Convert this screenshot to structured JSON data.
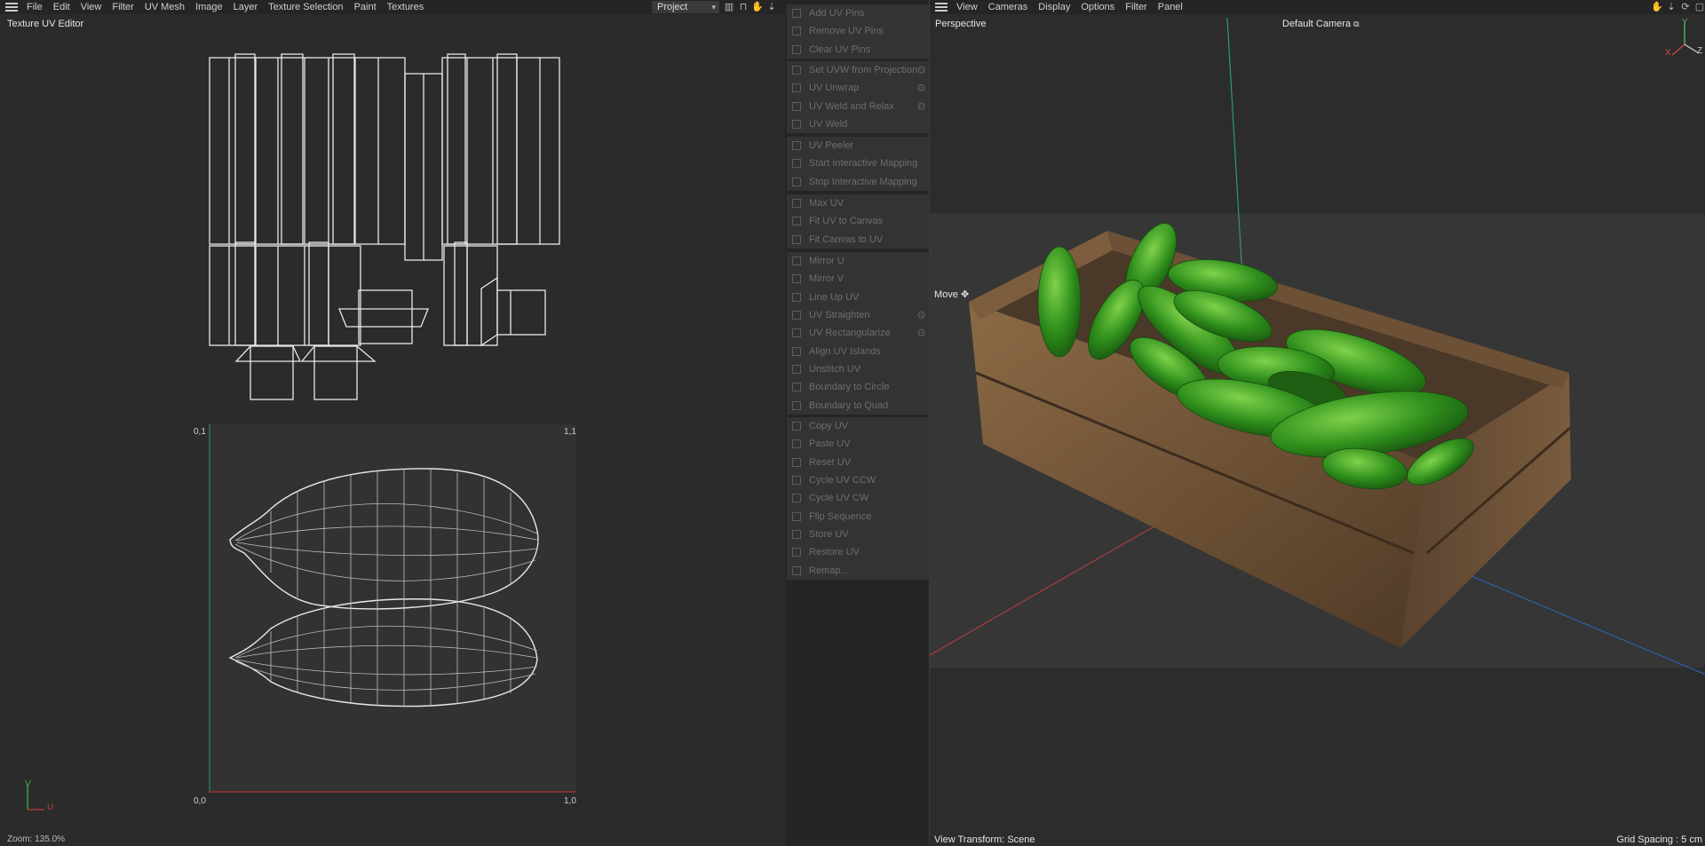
{
  "uv_editor": {
    "menu": [
      "File",
      "Edit",
      "View",
      "Filter",
      "UV Mesh",
      "Image",
      "Layer",
      "Texture Selection",
      "Paint",
      "Textures"
    ],
    "project_select": "Project",
    "title": "Texture UV Editor",
    "corners": {
      "top_left": "0,1",
      "top_right": "1,1",
      "bottom_left": "0,0",
      "bottom_right": "1,0"
    },
    "zoom": "Zoom: 135.0%",
    "axis_u": "U",
    "axis_v": "V"
  },
  "commands": {
    "groups": [
      {
        "items": [
          {
            "label": "Add UV Pins",
            "icon": "pin-icon"
          },
          {
            "label": "Remove UV Pins",
            "icon": "unpin-icon"
          },
          {
            "label": "Clear UV Pins",
            "icon": "close-icon"
          }
        ]
      },
      {
        "items": [
          {
            "label": "Set UVW from Projection",
            "icon": "projection-icon",
            "gear": true
          },
          {
            "label": "UV Unwrap",
            "icon": "unwrap-icon",
            "gear": true
          },
          {
            "label": "UV Weld and Relax",
            "icon": "weld-relax-icon",
            "gear": true
          },
          {
            "label": "UV Weld",
            "icon": "weld-icon"
          }
        ]
      },
      {
        "items": [
          {
            "label": "UV Peeler",
            "icon": "peeler-icon"
          },
          {
            "label": "Start Interactive Mapping",
            "icon": "play-icon"
          },
          {
            "label": "Stop Interactive Mapping",
            "icon": "stop-icon"
          }
        ]
      },
      {
        "items": [
          {
            "label": "Max UV",
            "icon": "max-icon"
          },
          {
            "label": "Fit UV to Canvas",
            "icon": "fit-uv-icon"
          },
          {
            "label": "Fit Canvas to UV",
            "icon": "fit-canvas-icon"
          }
        ]
      },
      {
        "items": [
          {
            "label": "Mirror U",
            "icon": "mirror-u-icon"
          },
          {
            "label": "Mirror V",
            "icon": "mirror-v-icon"
          },
          {
            "label": "Line Up UV",
            "icon": "line-up-icon"
          },
          {
            "label": "UV Straighten",
            "icon": "straighten-icon",
            "gear": true
          },
          {
            "label": "UV Rectangularize",
            "icon": "rectangularize-icon",
            "gear": true
          },
          {
            "label": "Align UV Islands",
            "icon": "align-icon"
          },
          {
            "label": "Unstitch UV",
            "icon": "unstitch-icon"
          },
          {
            "label": "Boundary to Circle",
            "icon": "circle-icon"
          },
          {
            "label": "Boundary to Quad",
            "icon": "quad-icon"
          }
        ]
      },
      {
        "items": [
          {
            "label": "Copy UV",
            "icon": "copy-icon"
          },
          {
            "label": "Paste UV",
            "icon": "paste-icon"
          },
          {
            "label": "Reset UV",
            "icon": "reset-icon"
          },
          {
            "label": "Cycle UV CCW",
            "icon": "ccw-icon"
          },
          {
            "label": "Cycle UV CW",
            "icon": "cw-icon"
          },
          {
            "label": "Flip Sequence",
            "icon": "flip-icon"
          },
          {
            "label": "Store UV",
            "icon": "store-icon"
          },
          {
            "label": "Restore UV",
            "icon": "restore-icon"
          },
          {
            "label": "Remap...",
            "icon": "remap-icon"
          }
        ]
      }
    ]
  },
  "viewport": {
    "menu": [
      "View",
      "Cameras",
      "Display",
      "Options",
      "Filter",
      "Panel"
    ],
    "perspective": "Perspective",
    "camera": "Default Camera",
    "move": "Move",
    "view_transform": "View Transform: Scene",
    "grid_spacing": "Grid Spacing : 5 cm",
    "axis_labels": {
      "x": "X",
      "y": "Y",
      "z": "Z"
    }
  }
}
